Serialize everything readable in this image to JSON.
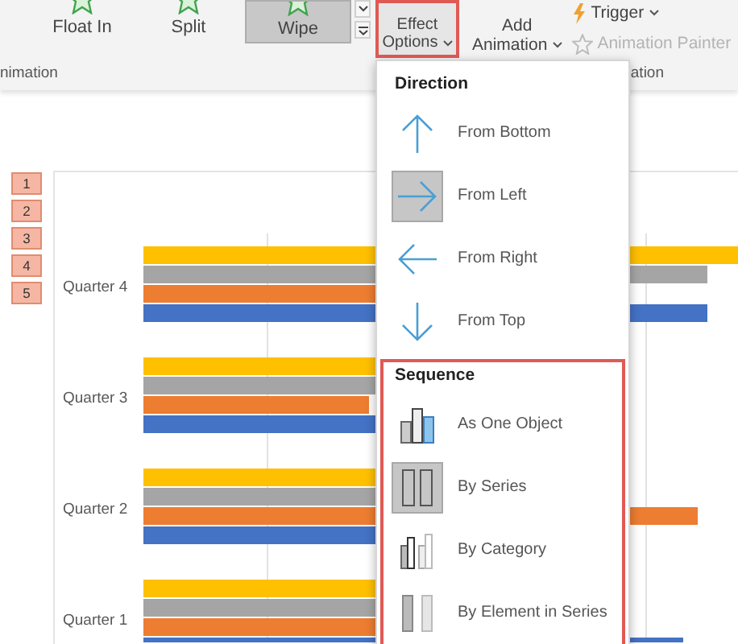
{
  "ribbon": {
    "gallery": [
      {
        "label": "Float In",
        "selected": false
      },
      {
        "label": "Split",
        "selected": false
      },
      {
        "label": "Wipe",
        "selected": true
      }
    ],
    "effect_options": {
      "lines": [
        "Effect",
        "Options"
      ],
      "highlighted": true
    },
    "add_animation": {
      "lines": [
        "Add",
        "Animation"
      ]
    },
    "trigger": {
      "label": "Trigger"
    },
    "animation_painter": {
      "label": "Animation Painter",
      "disabled": true
    },
    "group_labels": [
      "nimation",
      "ation"
    ]
  },
  "slide": {
    "animation_tags": [
      "1",
      "2",
      "3",
      "4",
      "5"
    ],
    "chart": {
      "categories": [
        "Quarter 4",
        "Quarter 3",
        "Quarter 2",
        "Quarter 1"
      ]
    }
  },
  "menu": {
    "sections": [
      {
        "title": "Direction",
        "highlighted": false,
        "items": [
          {
            "label": "From Bottom",
            "kind": "arrow-up",
            "selected": false
          },
          {
            "label": "From Left",
            "kind": "arrow-right",
            "selected": true
          },
          {
            "label": "From Right",
            "kind": "arrow-left",
            "selected": false
          },
          {
            "label": "From Top",
            "kind": "arrow-down",
            "selected": false
          }
        ]
      },
      {
        "title": "Sequence",
        "highlighted": true,
        "items": [
          {
            "label": "As One Object",
            "kind": "one-object",
            "selected": false
          },
          {
            "label": "By Series",
            "kind": "series",
            "selected": true
          },
          {
            "label": "By Category",
            "kind": "category",
            "selected": false
          },
          {
            "label": "By Element in Series",
            "kind": "element",
            "selected": false
          }
        ]
      }
    ]
  }
}
